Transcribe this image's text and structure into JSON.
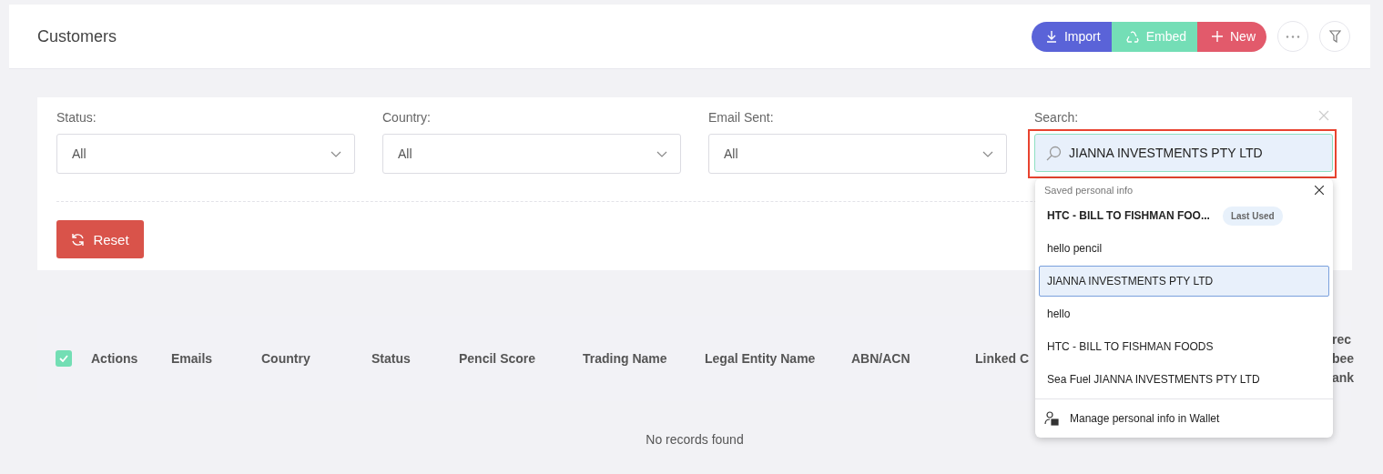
{
  "header": {
    "title": "Customers",
    "buttons": [
      {
        "kind": "import",
        "label": "Import"
      },
      {
        "kind": "embed",
        "label": "Embed"
      },
      {
        "kind": "new",
        "label": "New"
      }
    ]
  },
  "filters": [
    {
      "label": "Status:",
      "value": "All"
    },
    {
      "label": "Country:",
      "value": "All"
    },
    {
      "label": "Email Sent:",
      "value": "All"
    }
  ],
  "search": {
    "label": "Search:",
    "value": "JIANNA INVESTMENTS PTY LTD",
    "highlighted": true
  },
  "reset_button": "Reset",
  "autofill": {
    "title": "Saved personal info",
    "items": [
      {
        "label": "HTC - BILL TO FISHMAN FOO...",
        "badge": "Last Used",
        "selected": false
      },
      {
        "label": "hello pencil",
        "selected": false
      },
      {
        "label": "JIANNA INVESTMENTS PTY LTD",
        "selected": true
      },
      {
        "label": "hello",
        "selected": false
      },
      {
        "label": "HTC - BILL TO FISHMAN FOODS",
        "selected": false
      },
      {
        "label": "Sea Fuel JIANNA INVESTMENTS PTY LTD",
        "selected": false
      }
    ],
    "footer": "Manage personal info in Wallet"
  },
  "table": {
    "select_all_checked": true,
    "columns": [
      [
        "Actions"
      ],
      [
        "Emails"
      ],
      [
        "Country"
      ],
      [
        "Status"
      ],
      [
        "Pencil Score"
      ],
      [
        "Trading Name"
      ],
      [
        "Legal Entity Name"
      ],
      [
        "ABN/ACN"
      ],
      [
        "Linked C"
      ],
      [
        "rec",
        "bee",
        "ank"
      ]
    ],
    "empty_text": "No records found"
  }
}
